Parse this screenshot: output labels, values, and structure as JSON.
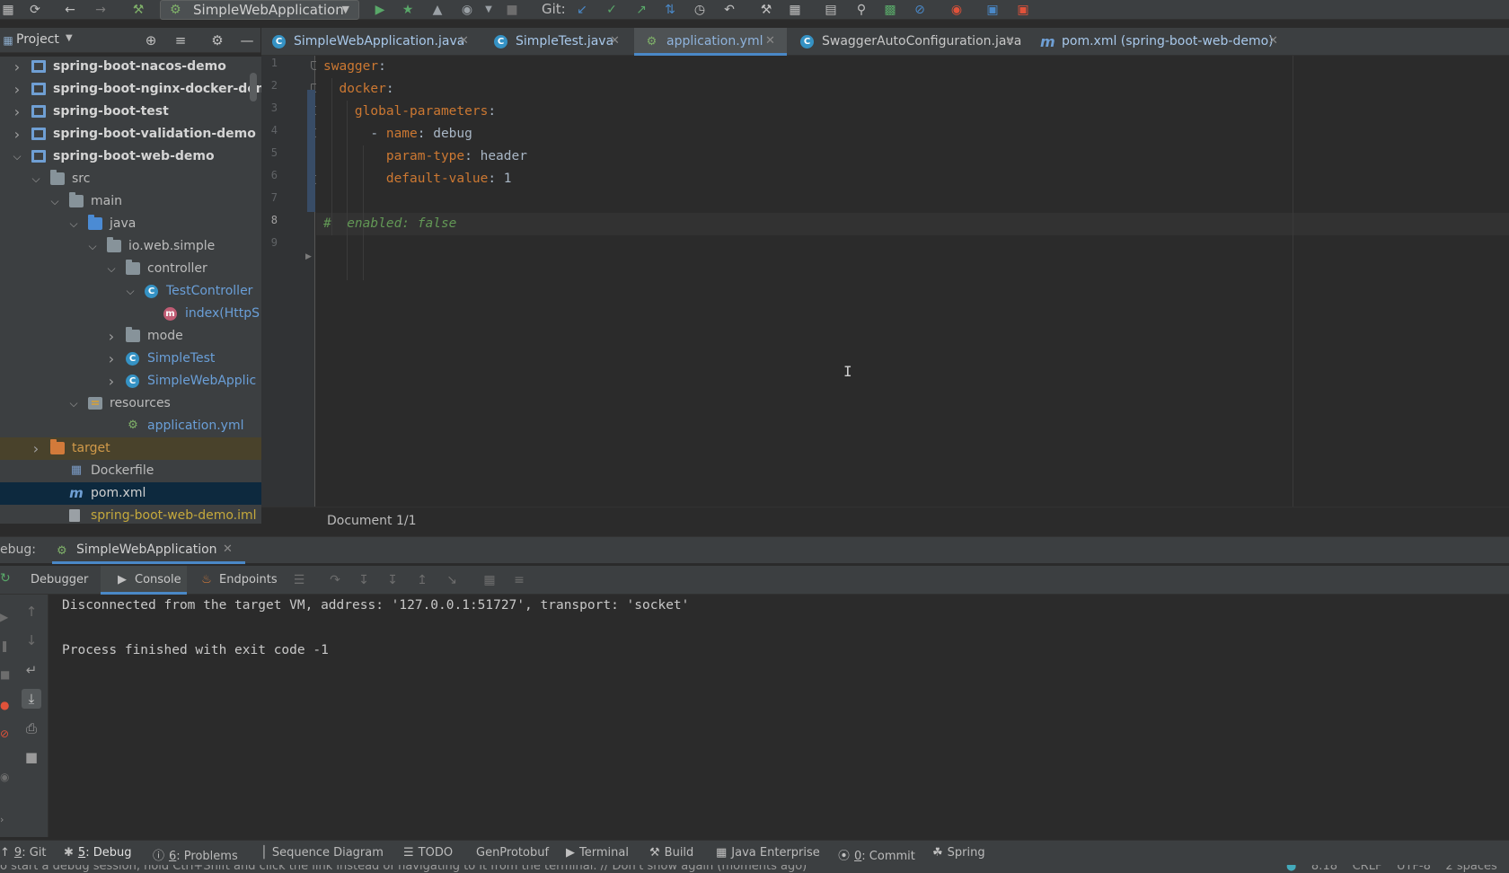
{
  "toolbar": {
    "run_config": "SimpleWebApplication",
    "git_label": "Git:",
    "icons": [
      "save-icon",
      "sync-icon",
      "back-icon",
      "forward-icon",
      "build-hammer-icon",
      "run-icon",
      "debug-icon",
      "coverage-icon",
      "profile-icon",
      "stop-icon",
      "git-update-icon",
      "git-commit-icon",
      "git-push-icon",
      "git-merge-icon",
      "git-history-icon",
      "git-rollback-icon",
      "settings-wrench-icon",
      "project-structure-icon",
      "terminal-icon",
      "search-icon",
      "plugin-icon",
      "disable-icon",
      "jrebel-icon",
      "translate-icon",
      "translate-alt-icon"
    ]
  },
  "project_panel": {
    "title": "Project",
    "tree": [
      {
        "label": "spring-boot-nacos-demo",
        "depth": 0,
        "arrow": "collapsed",
        "icon": "module",
        "bold": true
      },
      {
        "label": "spring-boot-nginx-docker-demo",
        "depth": 0,
        "arrow": "collapsed",
        "icon": "module",
        "bold": true
      },
      {
        "label": "spring-boot-test",
        "depth": 0,
        "arrow": "collapsed",
        "icon": "module",
        "bold": true
      },
      {
        "label": "spring-boot-validation-demo",
        "depth": 0,
        "arrow": "collapsed",
        "icon": "module",
        "bold": true
      },
      {
        "label": "spring-boot-web-demo",
        "depth": 0,
        "arrow": "expanded",
        "icon": "module",
        "bold": true
      },
      {
        "label": "src",
        "depth": 1,
        "arrow": "expanded",
        "icon": "folder"
      },
      {
        "label": "main",
        "depth": 2,
        "arrow": "expanded",
        "icon": "folder"
      },
      {
        "label": "java",
        "depth": 3,
        "arrow": "expanded",
        "icon": "src"
      },
      {
        "label": "io.web.simple",
        "depth": 4,
        "arrow": "expanded",
        "icon": "folder"
      },
      {
        "label": "controller",
        "depth": 5,
        "arrow": "expanded",
        "icon": "folder"
      },
      {
        "label": "TestController",
        "depth": 6,
        "arrow": "expanded",
        "icon": "class",
        "color": "#6a9fd8"
      },
      {
        "label": "index(HttpS",
        "depth": 7,
        "arrow": "",
        "icon": "method",
        "color": "#6a9fd8"
      },
      {
        "label": "mode",
        "depth": 5,
        "arrow": "collapsed",
        "icon": "folder"
      },
      {
        "label": "SimpleTest",
        "depth": 5,
        "arrow": "collapsed",
        "icon": "class",
        "color": "#6a9fd8"
      },
      {
        "label": "SimpleWebApplic",
        "depth": 5,
        "arrow": "collapsed",
        "icon": "class",
        "color": "#6a9fd8"
      },
      {
        "label": "resources",
        "depth": 3,
        "arrow": "expanded",
        "icon": "res"
      },
      {
        "label": "application.yml",
        "depth": 5,
        "arrow": "",
        "icon": "yml",
        "color": "#6a9fd8"
      },
      {
        "label": "target",
        "depth": 1,
        "arrow": "collapsed",
        "icon": "target",
        "color": "#d19a4a",
        "excluded": true
      },
      {
        "label": "Dockerfile",
        "depth": 2,
        "arrow": "",
        "icon": "docker"
      },
      {
        "label": "pom.xml",
        "depth": 2,
        "arrow": "",
        "icon": "maven",
        "selected": true,
        "color": "#d0d0d0"
      },
      {
        "label": "spring-boot-web-demo.iml",
        "depth": 2,
        "arrow": "",
        "icon": "iml",
        "color": "#c5a93c"
      }
    ]
  },
  "editor": {
    "tabs": [
      {
        "label": "SimpleWebApplication.java",
        "icon": "class",
        "active": false
      },
      {
        "label": "SimpleTest.java",
        "icon": "class",
        "active": false
      },
      {
        "label": "application.yml",
        "icon": "yml",
        "active": true
      },
      {
        "label": "SwaggerAutoConfiguration.java",
        "icon": "class",
        "active": false,
        "plain": true
      },
      {
        "label": "pom.xml (spring-boot-web-demo)",
        "icon": "maven",
        "active": false
      }
    ],
    "line_numbers": [
      "1",
      "2",
      "3",
      "4",
      "5",
      "6",
      "7",
      "8",
      "9"
    ],
    "current_line": "8",
    "lines": [
      [
        {
          "t": "swagger",
          "c": "k"
        },
        {
          "t": ":",
          "c": "v"
        }
      ],
      [
        {
          "t": "  docker",
          "c": "k"
        },
        {
          "t": ":",
          "c": "v"
        }
      ],
      [
        {
          "t": "    global-parameters",
          "c": "k"
        },
        {
          "t": ":",
          "c": "v"
        }
      ],
      [
        {
          "t": "      - ",
          "c": "v"
        },
        {
          "t": "name",
          "c": "k"
        },
        {
          "t": ": debug",
          "c": "v"
        }
      ],
      [
        {
          "t": "        param-type",
          "c": "k"
        },
        {
          "t": ": header",
          "c": "v"
        }
      ],
      [
        {
          "t": "        default-value",
          "c": "k"
        },
        {
          "t": ": 1",
          "c": "v"
        }
      ],
      [],
      [
        {
          "t": "#  enabled: false",
          "c": "cm"
        }
      ],
      []
    ],
    "breadcrumb": "Document 1/1"
  },
  "debug": {
    "label": "ebug:",
    "session": "SimpleWebApplication",
    "tabs": [
      "Debugger",
      "Console",
      "Endpoints"
    ],
    "active_tab": "Console",
    "console_lines": [
      "Disconnected from the target VM, address: '127.0.0.1:51727', transport: 'socket'",
      "",
      "Process finished with exit code -1"
    ]
  },
  "tool_windows": [
    {
      "prefix": "9",
      "label": ": Git",
      "icon": "git-icon"
    },
    {
      "prefix": "5",
      "label": ": Debug",
      "icon": "debug-icon",
      "active": true
    },
    {
      "prefix": "6",
      "label": ": Problems",
      "icon": "problems-icon"
    },
    {
      "prefix": "",
      "label": "Sequence Diagram",
      "icon": "sequence-icon"
    },
    {
      "prefix": "",
      "label": "TODO",
      "icon": "todo-icon"
    },
    {
      "prefix": "",
      "label": "GenProtobuf",
      "icon": ""
    },
    {
      "prefix": "",
      "label": "Terminal",
      "icon": "terminal-icon"
    },
    {
      "prefix": "",
      "label": "Build",
      "icon": "build-icon"
    },
    {
      "prefix": "",
      "label": "Java Enterprise",
      "icon": "java-enterprise-icon"
    },
    {
      "prefix": "0",
      "label": ": Commit",
      "icon": "commit-icon"
    },
    {
      "prefix": "",
      "label": "Spring",
      "icon": "spring-icon"
    }
  ],
  "status": {
    "message": "o start a debug session, hold Ctrl+Shift and click the link instead of navigating to it from the terminal. // Don't show again (moments ago)",
    "position": "8:18",
    "line_sep": "CRLF",
    "encoding": "UTF-8",
    "indent": "2 spaces"
  },
  "colors": {
    "accent": "#4a88c7",
    "yaml_key": "#cc7832",
    "comment": "#629755",
    "selection": "#0d293e"
  }
}
